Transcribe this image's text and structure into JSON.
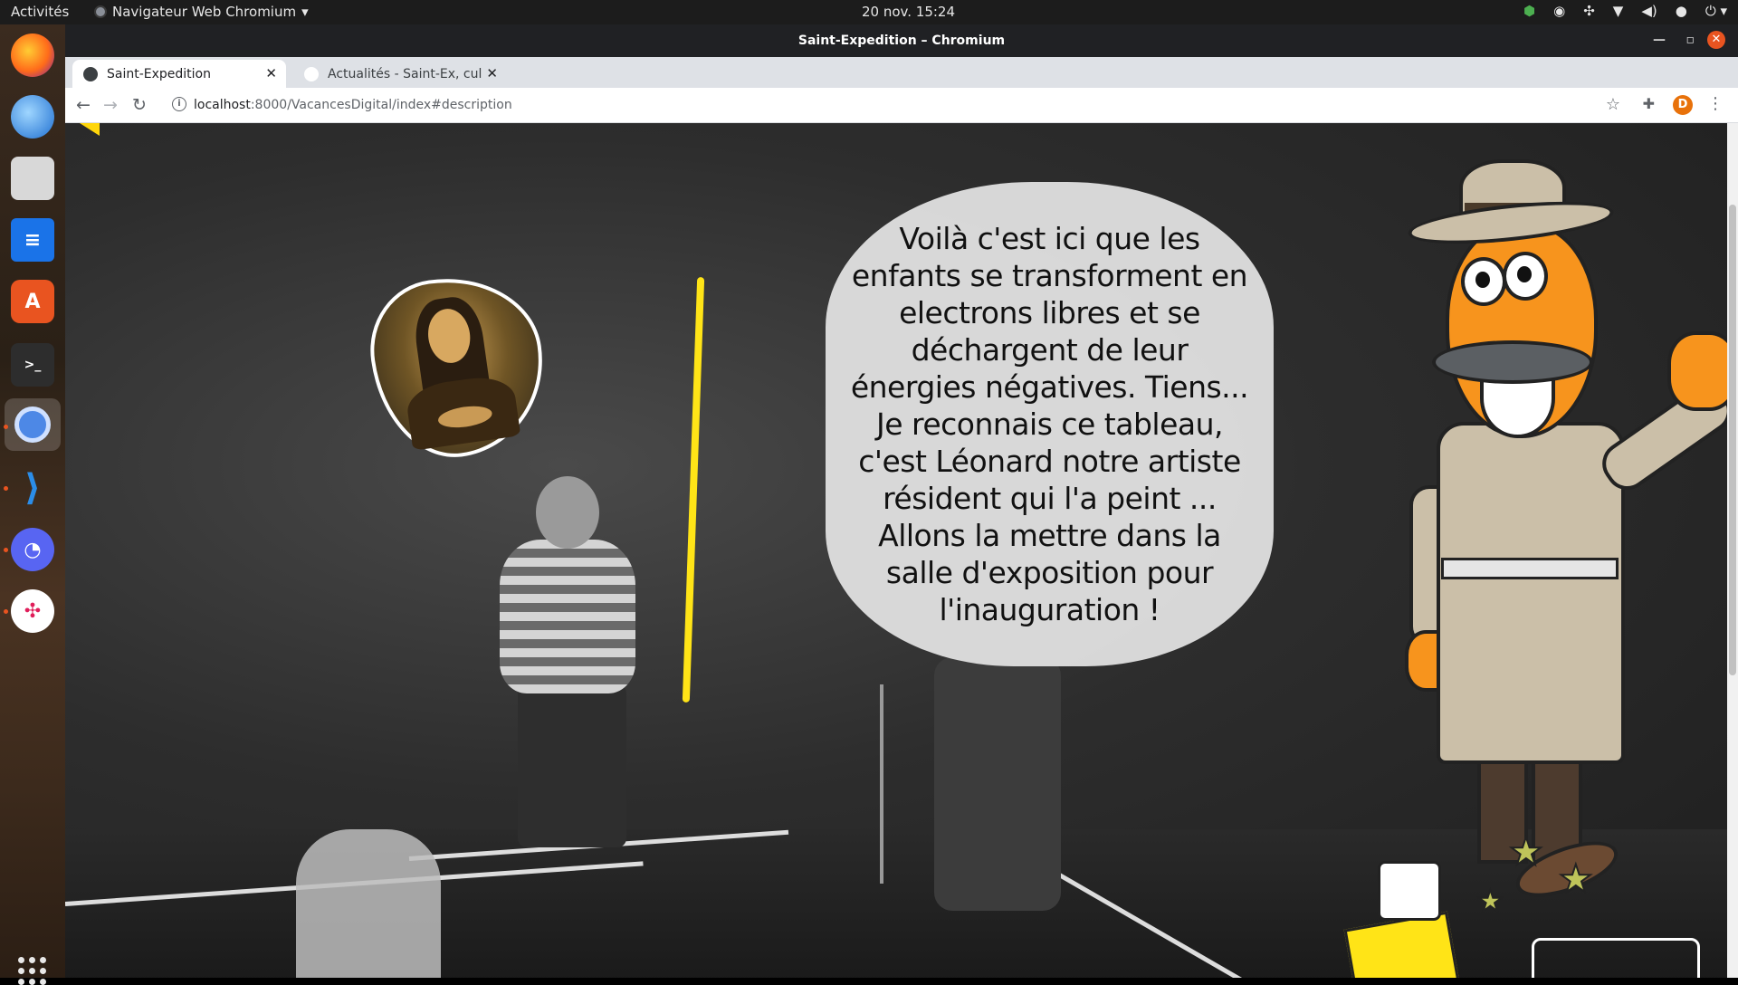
{
  "system": {
    "activities": "Activités",
    "app_menu": "Navigateur Web Chromium",
    "clock": "20 nov.  15:24"
  },
  "window": {
    "title": "Saint-Expedition – Chromium"
  },
  "tabs": [
    {
      "label": "Saint-Expedition",
      "active": true
    },
    {
      "label": "Actualités - Saint-Ex, cultu",
      "active": false
    }
  ],
  "address_bar": {
    "host": "localhost",
    "rest": ":8000/VacancesDigital/index#description"
  },
  "profile": {
    "initial": "D"
  },
  "page": {
    "speech_text": "Voilà c'est ici que les enfants se transforment en electrons libres et se déchargent de leur énergies négatives. Tiens... Je reconnais ce tableau, c'est Léonard notre artiste résident qui l'a peint ... Allons la mettre dans la salle d'exposition pour l'inauguration !"
  },
  "colors": {
    "accent_yellow": "#ffe417",
    "detective_orange": "#f7941d",
    "ubuntu_orange": "#e95420"
  },
  "icons": {
    "dock": [
      "firefox-icon",
      "thunderbird-icon",
      "files-icon",
      "writer-icon",
      "software-icon",
      "terminal-icon",
      "chromium-icon",
      "vscode-icon",
      "discord-icon",
      "slack-icon",
      "show-apps-icon"
    ]
  }
}
